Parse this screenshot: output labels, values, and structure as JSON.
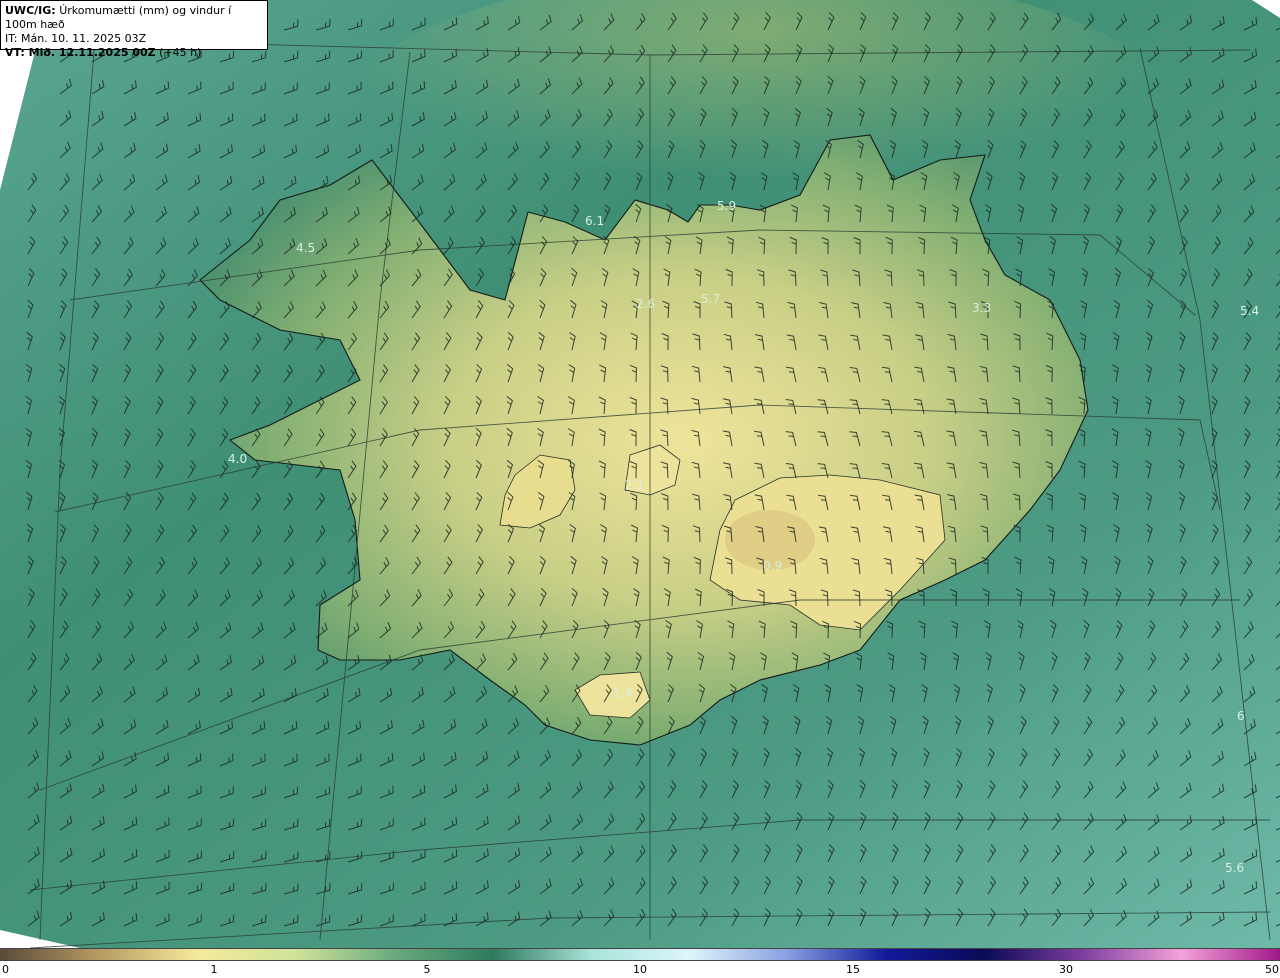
{
  "header": {
    "model": "UWC/IG:",
    "title": "Úrkomumætti (mm) og vindur í 100m hæð",
    "issue_time": "IT: Mán. 10. 11. 2025 03Z",
    "valid_prefix": "VT: Mið. 12.11.2025 00Z",
    "valid_offset": "(+45 h)"
  },
  "map_labels": [
    {
      "text": "6.1"
    },
    {
      "text": "5.9"
    },
    {
      "text": "4.5"
    },
    {
      "text": "2.6"
    },
    {
      "text": "5.7"
    },
    {
      "text": "3.3"
    },
    {
      "text": "5.4"
    },
    {
      "text": "4.0"
    },
    {
      "text": "2.1"
    },
    {
      "text": "0.9"
    },
    {
      "text": "1.4"
    },
    {
      "text": "6"
    },
    {
      "text": "5.6"
    }
  ],
  "legend": {
    "ticks": [
      "0",
      "1",
      "5",
      "10",
      "15",
      "30",
      "50"
    ],
    "colors": [
      "#5a4a3a",
      "#b59a62",
      "#f4ea9a",
      "#cfe39a",
      "#6aaa7e",
      "#2f7a5e",
      "#a9e3d9",
      "#ddf6fb",
      "#8a9fe0",
      "#121a9a",
      "#0a0a55",
      "#7f3fa0",
      "#f2a2d8",
      "#a0188a"
    ]
  },
  "colors": {
    "ocean": "#4f9a86",
    "land_low": "#5e9a6e",
    "land_high": "#e9dd8d",
    "barb": "#1e2a24",
    "grid": "#2b3b34"
  }
}
